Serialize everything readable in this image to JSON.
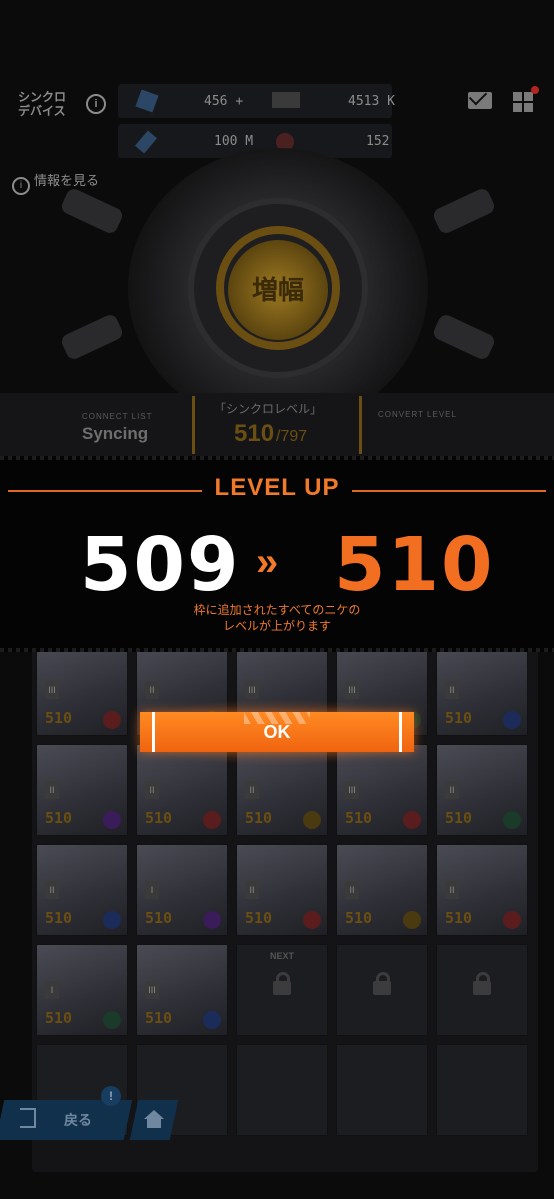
{
  "header": {
    "title_line1": "シンクロ",
    "title_line2": "デバイス",
    "info_icon": "info-icon",
    "resources": [
      {
        "icon": "crystal-icon",
        "value": "456",
        "add_label": "+"
      },
      {
        "icon": "credit-icon",
        "value": "4513 K"
      },
      {
        "icon": "battle-data-icon",
        "value": "100 M"
      },
      {
        "icon": "core-dust-icon",
        "value": "152"
      }
    ],
    "mail_icon": "mail-icon",
    "menu_icon": "grid-menu-icon",
    "info_link": "情報を見る"
  },
  "device": {
    "core_label": "増幅"
  },
  "connect": {
    "left_label": "CONNECT LIST",
    "left_value": "Syncing",
    "mid_label": "「シンクロレベル」",
    "mid_value": "510",
    "mid_max": "/797",
    "right_label": "CONVERT LEVEL"
  },
  "grid": {
    "level": "510",
    "next_label": "NEXT",
    "ranks": [
      "III",
      "II",
      "III",
      "III",
      "II",
      "II",
      "II",
      "II",
      "III",
      "II",
      "II",
      "I",
      "II",
      "II",
      "II",
      "I",
      "III"
    ]
  },
  "level_up": {
    "title": "LEVEL UP",
    "old_level": "509",
    "arrow": "»",
    "new_level": "510",
    "desc_line1": "枠に追加されたすべてのニケの",
    "desc_line2": "レベルが上がります",
    "ok_label": "OK"
  },
  "nav": {
    "back_label": "戻る",
    "badge": "!",
    "home_icon": "home-icon"
  },
  "colors": {
    "accent": "#f26f21",
    "background": "#0b0b0c"
  }
}
